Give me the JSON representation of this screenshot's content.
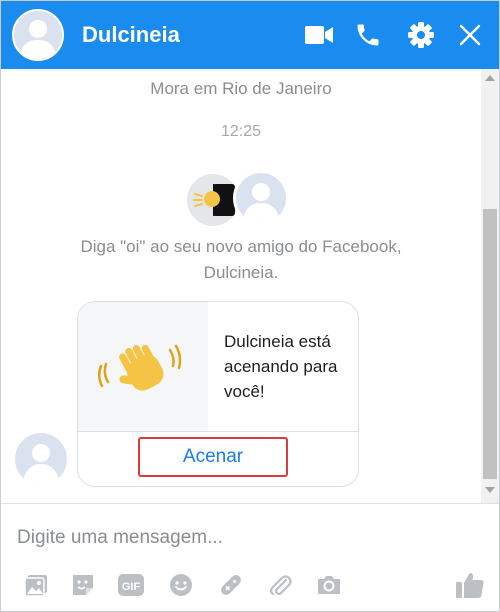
{
  "header": {
    "title": "Dulcineia",
    "icons": [
      "video-camera-icon",
      "phone-icon",
      "gear-icon",
      "close-icon"
    ]
  },
  "chat": {
    "location": "Mora em Rio de Janeiro",
    "time": "12:25",
    "intro_line1": "Diga \"oi\" ao seu novo amigo do Facebook,",
    "intro_line2": "Dulcineia.",
    "wave_card": {
      "text_line1": "Dulcineia está",
      "text_line2": "acenando para",
      "text_line3": "você!",
      "button_label": "Acenar"
    }
  },
  "composer": {
    "placeholder": "Digite uma mensagem...",
    "value": "",
    "tools": [
      "image-icon",
      "sticker-icon",
      "gif-icon",
      "emoji-icon",
      "game-icon",
      "attachment-icon",
      "camera-icon"
    ],
    "gif_label": "GIF"
  },
  "colors": {
    "header_bg": "#1a8cf0",
    "accent": "#1a7cf2",
    "highlight": "#d93a3a",
    "wave_emoji": "#f6c445"
  }
}
